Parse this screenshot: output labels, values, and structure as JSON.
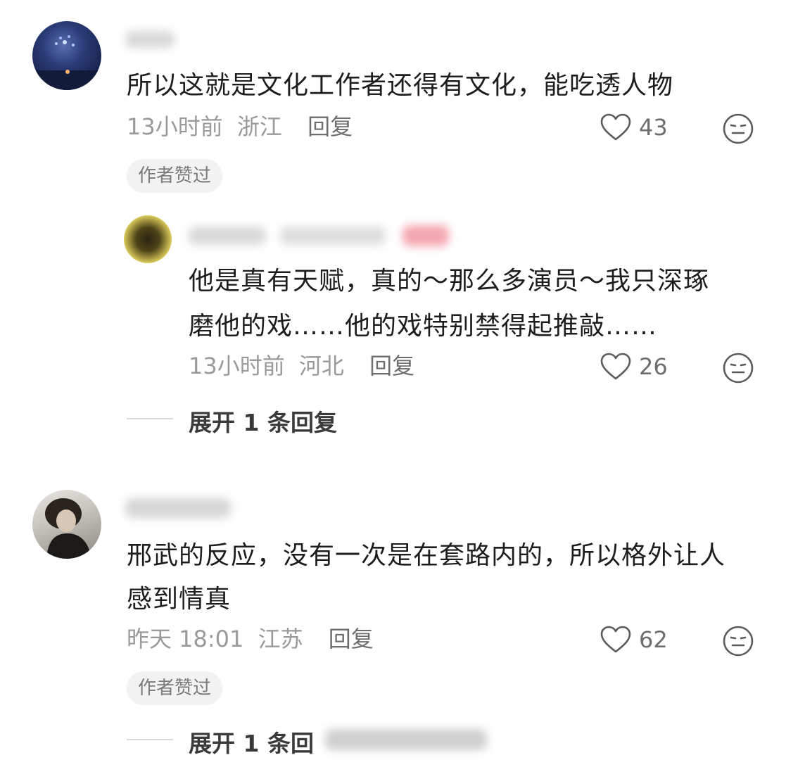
{
  "comments": [
    {
      "text": "所以这就是文化工作者还得有文化，能吃透人物",
      "time": "13小时前",
      "location": "浙江",
      "reply_label": "回复",
      "likes": "43",
      "badge": "作者赞过",
      "reply": {
        "text_line1": "他是真有天赋，真的～那么多演员～我只深琢",
        "text_line2": "磨他的戏……他的戏特别禁得起推敲……",
        "time": "13小时前",
        "location": "河北",
        "reply_label": "回复",
        "likes": "26"
      },
      "expand": "展开 1 条回复"
    },
    {
      "text_line1": "邢武的反应，没有一次是在套路内的，所以格外让人",
      "text_line2": "感到情真",
      "time": "昨天 18:01",
      "location": "江苏",
      "reply_label": "回复",
      "likes": "62",
      "badge": "作者赞过",
      "expand": "展开 1 条回"
    }
  ],
  "icons": {
    "like": "heart-outline-icon",
    "reaction": "neutral-face-icon"
  },
  "colors": {
    "meta": "#9a9a9a",
    "chip_bg": "#f2f2f2",
    "accent_blur": "#f4a7b0"
  }
}
